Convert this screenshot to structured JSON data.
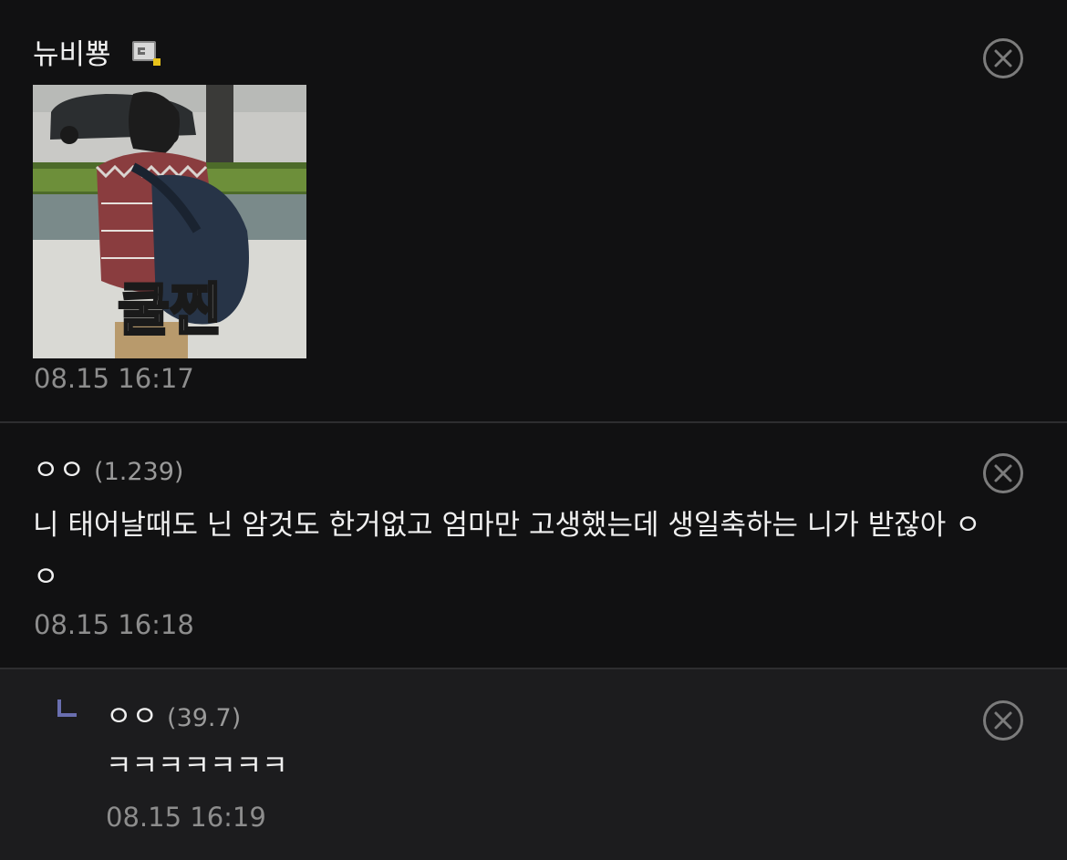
{
  "comments": [
    {
      "nickname": "뉴비뿅",
      "level_icon": "gonic-level-icon",
      "image": {
        "caption": "쿨찐"
      },
      "date": "08.15 16:17"
    },
    {
      "nickname": "ㅇㅇ",
      "ip": "(1.239)",
      "text": "니 태어날때도 닌 암것도 한거없고 엄마만 고생했는데 생일축하는 니가 받잖아 ㅇㅇ",
      "date": "08.15 16:18"
    },
    {
      "reply_icon": "reply-corner-icon",
      "nickname": "ㅇㅇ",
      "ip": "(39.7)",
      "text": "ㅋㅋㅋㅋㅋㅋㅋ",
      "date": "08.15 16:19"
    }
  ],
  "colors": {
    "background": "#111112",
    "reply_background": "#1c1c1e",
    "text": "#f0f0f0",
    "muted": "#8d8d8d",
    "reply_mark": "#6a6fb0"
  }
}
